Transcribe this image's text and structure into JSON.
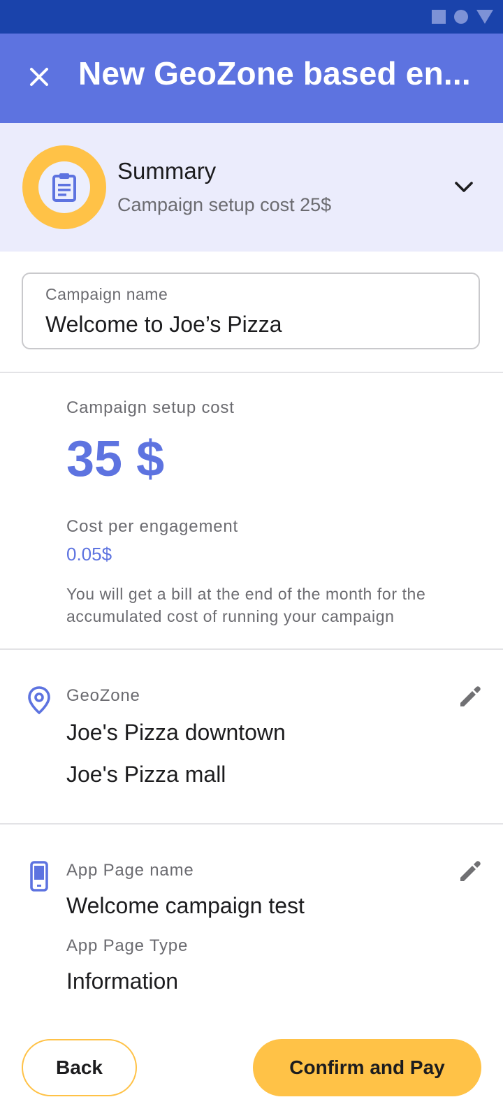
{
  "app_bar": {
    "title": "New GeoZone based en...",
    "close_icon": "close-icon"
  },
  "summary": {
    "title": "Summary",
    "subtitle": "Campaign setup cost 25$",
    "icon": "clipboard-icon",
    "expand_icon": "chevron-down-icon"
  },
  "campaign_name": {
    "label": "Campaign name",
    "value": "Welcome to Joe’s Pizza"
  },
  "costs": {
    "setup_label": "Campaign setup cost",
    "setup_value": "35 $",
    "engagement_label": "Cost per engagement",
    "engagement_value": "0.05$",
    "note": "You will get a bill at the end of the month for the accumulated cost of running your campaign"
  },
  "geozone": {
    "label": "GeoZone",
    "icon": "location-pin-icon",
    "items": [
      "Joe's Pizza downtown",
      "Joe's Pizza mall"
    ],
    "edit_icon": "pencil-icon"
  },
  "app_page": {
    "name_label": "App Page name",
    "name_value": "Welcome campaign test",
    "type_label": "App Page Type",
    "type_value": "Information",
    "icon": "phone-icon",
    "edit_icon": "pencil-icon"
  },
  "actions": {
    "back_label": "Back",
    "confirm_label": "Confirm and Pay"
  },
  "colors": {
    "status_bar": "#1a43ab",
    "app_bar": "#5d73e0",
    "summary_bg": "#ebecfc",
    "accent": "#5d73e0",
    "button_yellow": "#ffc247"
  }
}
